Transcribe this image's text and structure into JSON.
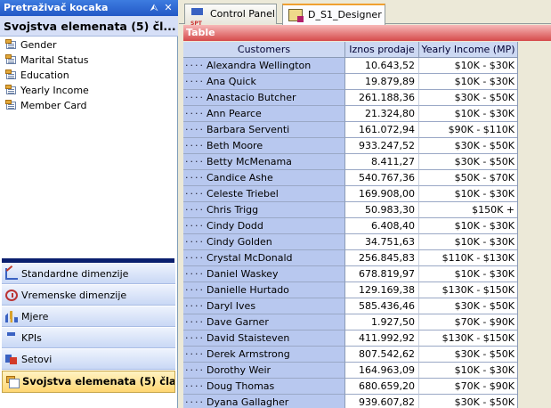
{
  "left_panel": {
    "title": "Pretraživač kocaka",
    "pin_glyph": "⮙",
    "close_glyph": "✕",
    "properties_header": "Svojstva elemenata (5)  čl...",
    "properties": [
      "Gender",
      "Marital Status",
      "Education",
      "Yearly Income",
      "Member Card"
    ],
    "nav": [
      {
        "label": "Standardne dimenzije",
        "icon": "standard-dimensions-icon"
      },
      {
        "label": "Vremenske dimenzije",
        "icon": "time-dimensions-icon"
      },
      {
        "label": "Mjere",
        "icon": "measures-icon"
      },
      {
        "label": "KPIs",
        "icon": "kpi-icon"
      },
      {
        "label": "Setovi",
        "icon": "sets-icon"
      },
      {
        "label": "Svojstva elemenata (5)  čla...",
        "icon": "member-properties-icon",
        "active": true
      }
    ]
  },
  "tabs": [
    {
      "label": "Control Panel",
      "icon": "control-panel-icon",
      "active": false
    },
    {
      "label": "D_S1_Designer",
      "icon": "designer-icon",
      "active": true
    }
  ],
  "table": {
    "title": "Table",
    "columns": [
      "Customers",
      "Iznos prodaje",
      "Yearly Income (MP)"
    ],
    "row_prefix": "····",
    "rows": [
      [
        "Alexandra Wellington",
        "10.643,52",
        "$10K - $30K"
      ],
      [
        "Ana Quick",
        "19.879,89",
        "$10K - $30K"
      ],
      [
        "Anastacio Butcher",
        "261.188,36",
        "$30K - $50K"
      ],
      [
        "Ann Pearce",
        "21.324,80",
        "$10K - $30K"
      ],
      [
        "Barbara Serventi",
        "161.072,94",
        "$90K - $110K"
      ],
      [
        "Beth Moore",
        "933.247,52",
        "$30K - $50K"
      ],
      [
        "Betty McMenama",
        "8.411,27",
        "$30K - $50K"
      ],
      [
        "Candice Ashe",
        "540.767,36",
        "$50K - $70K"
      ],
      [
        "Celeste Triebel",
        "169.908,00",
        "$10K - $30K"
      ],
      [
        "Chris Trigg",
        "50.983,30",
        "$150K +"
      ],
      [
        "Cindy Dodd",
        "6.408,40",
        "$10K - $30K"
      ],
      [
        "Cindy Golden",
        "34.751,63",
        "$10K - $30K"
      ],
      [
        "Crystal McDonald",
        "256.845,83",
        "$110K - $130K"
      ],
      [
        "Daniel Waskey",
        "678.819,97",
        "$10K - $30K"
      ],
      [
        "Danielle Hurtado",
        "129.169,38",
        "$130K - $150K"
      ],
      [
        "Daryl Ives",
        "585.436,46",
        "$30K - $50K"
      ],
      [
        "Dave Garner",
        "1.927,50",
        "$70K - $90K"
      ],
      [
        "David Staisteven",
        "411.992,92",
        "$130K - $150K"
      ],
      [
        "Derek Armstrong",
        "807.542,62",
        "$30K - $50K"
      ],
      [
        "Dorothy Weir",
        "164.963,09",
        "$10K - $30K"
      ],
      [
        "Doug Thomas",
        "680.659,20",
        "$70K - $90K"
      ],
      [
        "Dyana Gallagher",
        "939.607,82",
        "$30K - $50K"
      ]
    ]
  }
}
